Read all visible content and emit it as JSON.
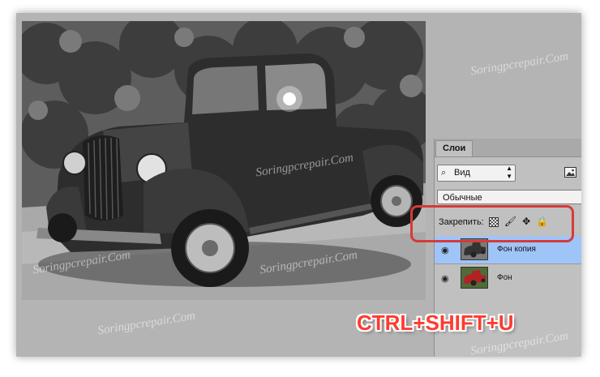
{
  "layers_panel": {
    "tab_label": "Слои",
    "filter": {
      "value": "Вид",
      "search_icon": "magnifier-icon",
      "image_filter_icon": "image-filter-icon"
    },
    "blend_mode": "Обычные",
    "lock": {
      "label": "Закрепить:",
      "icons": [
        "lock-transparent-pixels-icon",
        "lock-image-pixels-icon",
        "lock-position-icon",
        "lock-all-icon"
      ]
    },
    "layers": [
      {
        "name": "Фон копия",
        "visible": true,
        "selected": true
      },
      {
        "name": "Фон",
        "visible": true,
        "selected": false
      }
    ]
  },
  "annotation": {
    "shortcut": "CTRL+SHIFT+U",
    "highlight_color": "#d63a3a",
    "shortcut_color": "#ff3b30"
  },
  "watermark_text": "Soringpcrepair.Com",
  "colors": {
    "workspace": "#b4b4b4",
    "panel": "#c0c0c0",
    "selection": "#9fc4f8"
  }
}
